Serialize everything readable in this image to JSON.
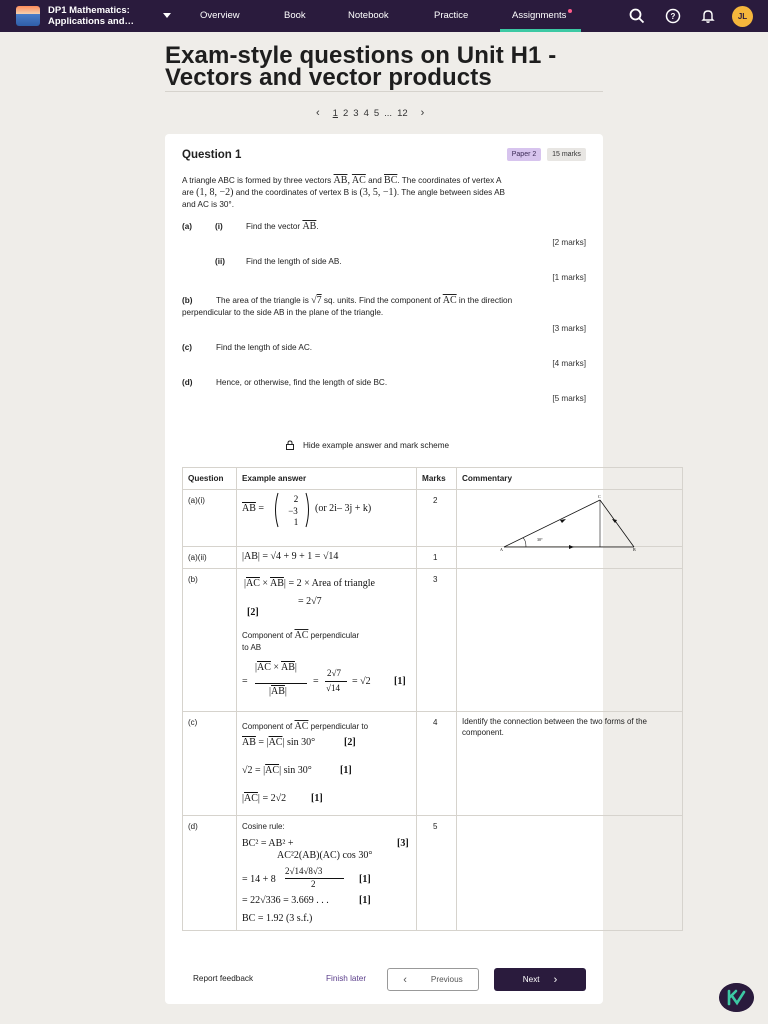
{
  "nav": {
    "course_title": "DP1 Mathematics: Applications and…",
    "links": [
      "Overview",
      "Book",
      "Notebook",
      "Practice",
      "Assignments"
    ],
    "avatar": "JL"
  },
  "page": {
    "title": "Exam-style questions on Unit H1 - Vectors and vector products",
    "pages": [
      "1",
      "2",
      "3",
      "4",
      "5",
      "...",
      "12"
    ]
  },
  "question": {
    "title": "Question 1",
    "paper": "Paper 2",
    "marks": "15 marks",
    "intro_l1": "A triangle ABC is formed by three vectors",
    "intro_l1b": ". The coordinates of vertex A",
    "intro_l2a": "are",
    "intro_l2b": "and the coordinates of vertex B is",
    "intro_l2c": ". The angle between sides AB",
    "intro_l3": "and AC is 30°.",
    "coordA": "(1, 8, −2)",
    "coordB": "(3, 5, −1)",
    "parts": {
      "a": "(a)",
      "i": "(i)",
      "ii": "(ii)",
      "b": "(b)",
      "c": "(c)",
      "d": "(d)",
      "a_i_text": "Find the vector",
      "a_ii_text": "Find the length of side AB.",
      "b_text_l1a": "The area of the triangle is",
      "b_text_l1b": "sq. units. Find the component of",
      "b_text_l1c": "in the direction",
      "b_text_l2": "perpendicular to the side AB in the plane of the triangle.",
      "c_text": "Find the length of side AC.",
      "d_text": "Hence, or otherwise, find the length of side BC."
    },
    "marks_list": [
      "[2 marks]",
      "[1 marks]",
      "[3 marks]",
      "[4 marks]",
      "[5 marks]"
    ],
    "hide_label": "Hide example answer and mark scheme"
  },
  "table": {
    "headers": [
      "Question",
      "Example answer",
      "Marks",
      "Commentary"
    ],
    "rows": {
      "ai": {
        "q": "(a)(i)",
        "marks": "2",
        "alt": "(or 2i– 3j + k)"
      },
      "aii": {
        "q": "(a)(ii)",
        "marks": "1",
        "expr": "|AB| = √4 + 9 + 1 = √14"
      },
      "b": {
        "q": "(b)",
        "marks": "3",
        "l1": "= 2 × Area of triangle",
        "l2": "= 2√7",
        "m1": "[2]",
        "t1": "Component of",
        "t1b": "perpendicular",
        "t2": "to AB",
        "res": "= √2",
        "m2": "[1]"
      },
      "c": {
        "q": "(c)",
        "marks": "4",
        "t1": "Component of",
        "t1b": "perpendicular to",
        "l1": "sin 30°",
        "m1": "[2]",
        "l2a": "√2 =",
        "l2": "sin 30°",
        "m2": "[1]",
        "l3": "= 2√2",
        "m3": "[1]",
        "comment": "Identify the connection between the two forms of the component."
      },
      "d": {
        "q": "(d)",
        "marks": "5",
        "t1": "Cosine rule:",
        "l1": "BC² = AB² +",
        "m1": "[3]",
        "l2": "AC²2(AB)(AC) cos 30°",
        "l3a": "= 14 + 8",
        "frac_num": "2√14√8√3",
        "frac_den": "2",
        "m2": "[1]",
        "l4": "= 22√336 = 3.669 . . .",
        "m3": "[1]",
        "l5": "BC = 1.92 (3 s.f.)"
      }
    },
    "diagram": {
      "A": "A",
      "B": "B",
      "C": "C",
      "angle": "30°"
    }
  },
  "footer": {
    "report": "Report feedback",
    "finish": "Finish later",
    "previous": "Previous",
    "next": "Next"
  },
  "colors": {
    "nav_bg": "#2a1b3d",
    "accent": "#3cc9a4",
    "paper_badge": "#d7c4ee"
  }
}
